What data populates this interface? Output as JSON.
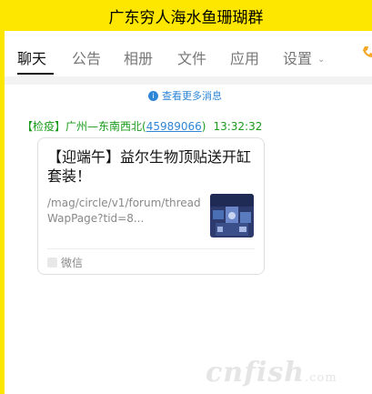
{
  "window": {
    "title": "广东穷人海水鱼珊瑚群"
  },
  "tabs": [
    {
      "label": "聊天",
      "active": true
    },
    {
      "label": "公告"
    },
    {
      "label": "相册"
    },
    {
      "label": "文件"
    },
    {
      "label": "应用"
    },
    {
      "label": "设置"
    }
  ],
  "history": {
    "label": "查看更多消息"
  },
  "message": {
    "sender_prefix": "【检疫】广州—东南西北(",
    "qq": "45989066",
    "sender_suffix": ")",
    "time": "13:32:32",
    "card": {
      "title": "【迎端午】益尔生物顶贴送开缸套装！",
      "url": "/mag/circle/v1/forum/threadWapPage?tid=8...",
      "source": "微信"
    }
  },
  "watermark": {
    "text": "cnfish",
    "suffix": ".com"
  },
  "colors": {
    "titlebar": "#fde700",
    "sender": "#1a9a1a",
    "link": "#2f86d6"
  }
}
